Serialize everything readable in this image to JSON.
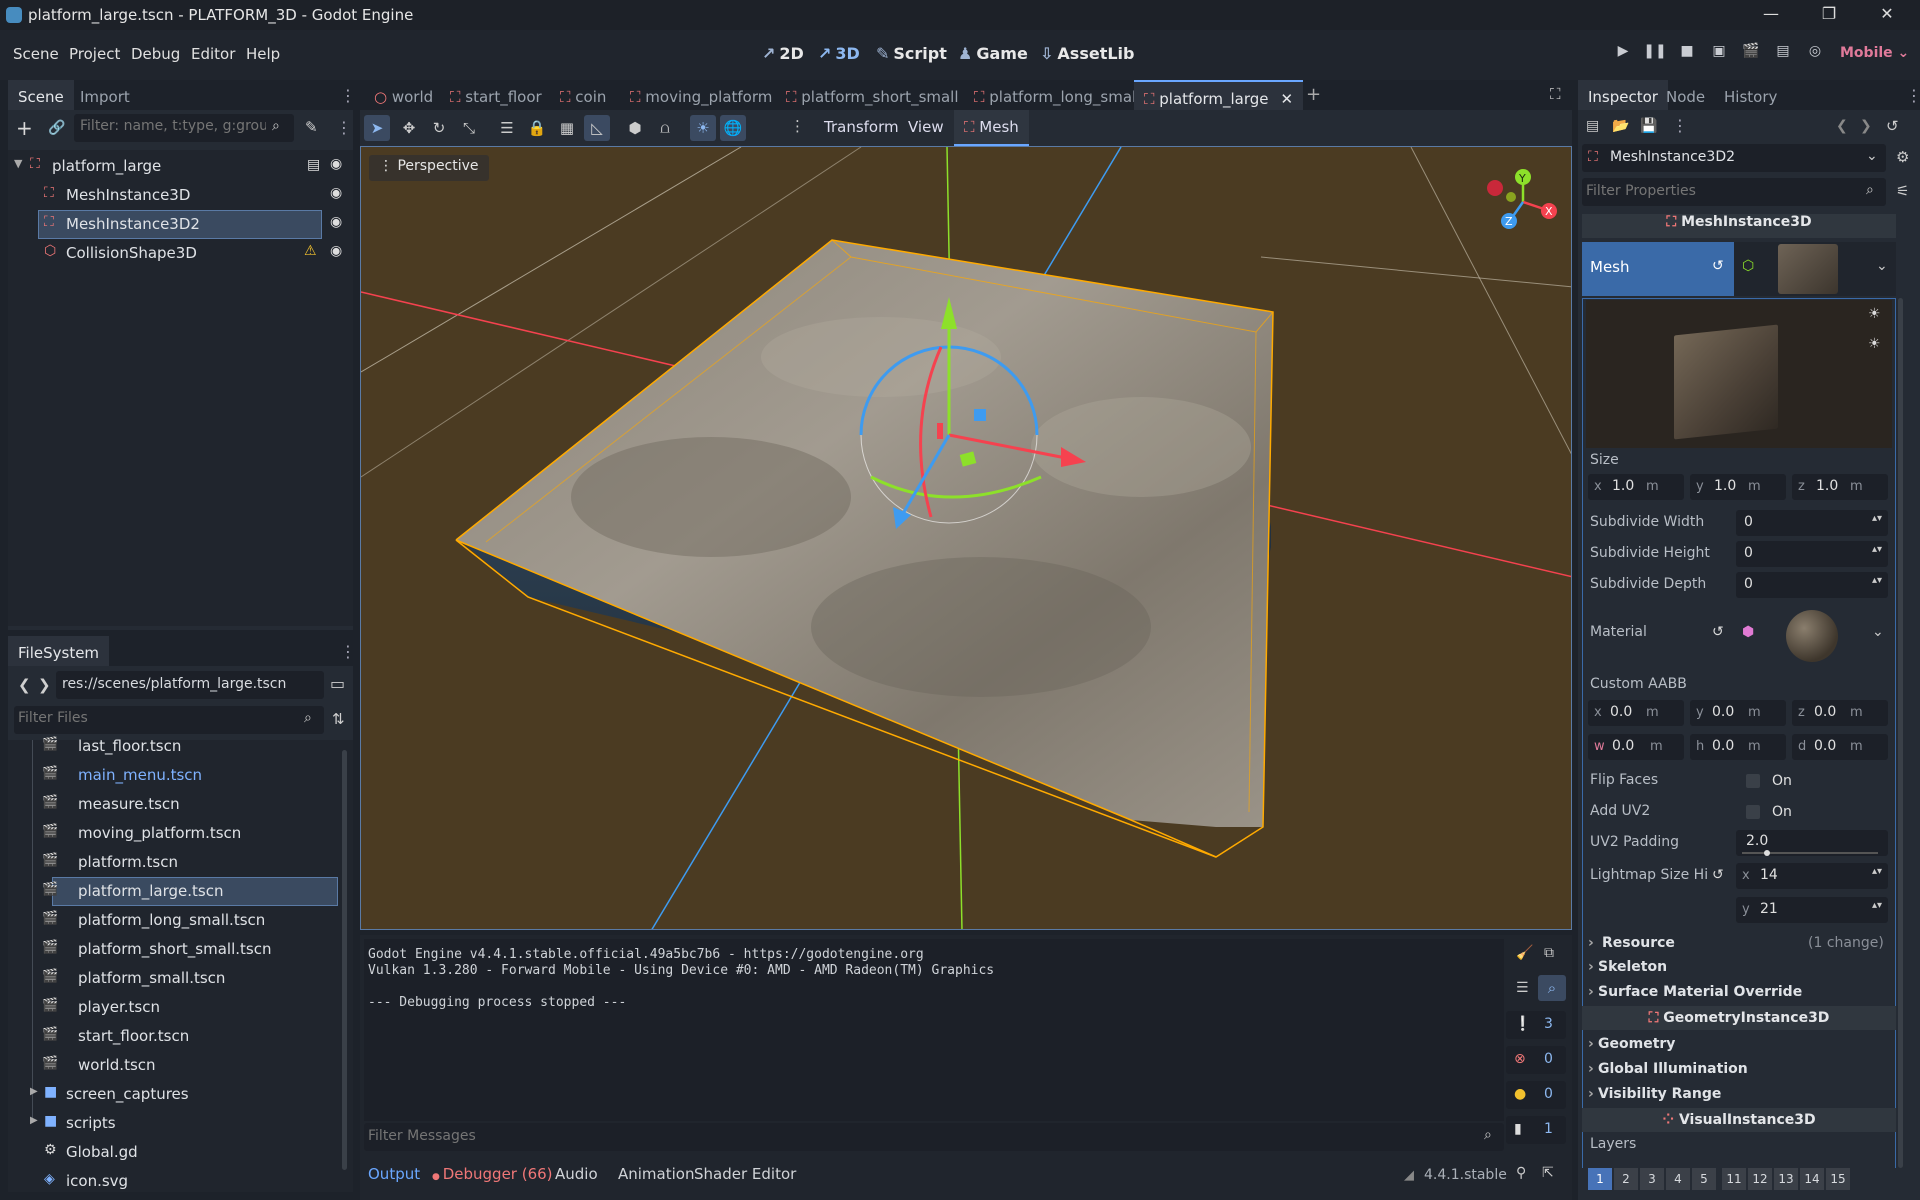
{
  "window": {
    "title": "platform_large.tscn - PLATFORM_3D - Godot Engine"
  },
  "menu": [
    "Scene",
    "Project",
    "Debug",
    "Editor",
    "Help"
  ],
  "workspaces": [
    {
      "label": "2D",
      "icon": "2d-icon"
    },
    {
      "label": "3D",
      "icon": "3d-icon"
    },
    {
      "label": "Script",
      "icon": "script-icon"
    },
    {
      "label": "Game",
      "icon": "game-icon"
    },
    {
      "label": "AssetLib",
      "icon": "assetlib-icon"
    }
  ],
  "renderer": "Mobile",
  "scene_panel": {
    "tabs": [
      "Scene",
      "Import"
    ],
    "filter_placeholder": "Filter: name, t:type, g:group",
    "nodes": [
      {
        "label": "platform_large",
        "level": 0
      },
      {
        "label": "MeshInstance3D",
        "level": 1
      },
      {
        "label": "MeshInstance3D2",
        "level": 1,
        "selected": true
      },
      {
        "label": "CollisionShape3D",
        "level": 1,
        "warning": true
      }
    ]
  },
  "filesystem": {
    "tab": "FileSystem",
    "path": "res://scenes/platform_large.tscn",
    "filter_placeholder": "Filter Files",
    "files": [
      {
        "label": "last_floor.tscn"
      },
      {
        "label": "main_menu.tscn",
        "highlight": true
      },
      {
        "label": "measure.tscn"
      },
      {
        "label": "moving_platform.tscn"
      },
      {
        "label": "platform.tscn"
      },
      {
        "label": "platform_large.tscn",
        "selected": true
      },
      {
        "label": "platform_long_small.tscn"
      },
      {
        "label": "platform_short_small.tscn"
      },
      {
        "label": "platform_small.tscn"
      },
      {
        "label": "player.tscn"
      },
      {
        "label": "start_floor.tscn"
      },
      {
        "label": "world.tscn"
      }
    ],
    "folders": [
      "screen_captures",
      "scripts"
    ],
    "root_files": [
      "Global.gd",
      "icon.svg"
    ]
  },
  "scene_tabs": [
    "world",
    "start_floor",
    "coin",
    "moving_platform",
    "platform_short_small",
    "platform_long_small",
    "platform_large"
  ],
  "active_scene_tab": "platform_large",
  "toolbar": {
    "transform": "Transform",
    "view": "View",
    "mesh": "Mesh"
  },
  "viewport": {
    "perspective": "Perspective"
  },
  "inspector": {
    "tabs": [
      "Inspector",
      "Node",
      "History"
    ],
    "node_name": "MeshInstance3D2",
    "filter_placeholder": "Filter Properties",
    "class_header": "MeshInstance3D",
    "mesh_label": "Mesh",
    "size_label": "Size",
    "size": {
      "x": "1.0",
      "y": "1.0",
      "z": "1.0",
      "unit": "m"
    },
    "subdivide": [
      {
        "label": "Subdivide Width",
        "value": "0"
      },
      {
        "label": "Subdivide Height",
        "value": "0"
      },
      {
        "label": "Subdivide Depth",
        "value": "0"
      }
    ],
    "material_label": "Material",
    "aabb_label": "Custom AABB",
    "aabb": {
      "x": "0.0",
      "y": "0.0",
      "z": "0.0",
      "w": "0.0",
      "h": "0.0",
      "d": "0.0"
    },
    "flip_faces": {
      "label": "Flip Faces",
      "value": "On"
    },
    "add_uv2": {
      "label": "Add UV2",
      "value": "On"
    },
    "uv2_padding": {
      "label": "UV2 Padding",
      "value": "2.0"
    },
    "lightmap": {
      "label": "Lightmap Size Hi",
      "x": "14",
      "y": "21"
    },
    "resource": {
      "label": "Resource",
      "changes": "(1 change)"
    },
    "sections": [
      "Skeleton",
      "Surface Material Override"
    ],
    "geometry_header": "GeometryInstance3D",
    "geometry_sections": [
      "Geometry",
      "Global Illumination",
      "Visibility Range"
    ],
    "visual_header": "VisualInstance3D",
    "layers_label": "Layers",
    "layers": [
      "1",
      "2",
      "3",
      "4",
      "5",
      "11",
      "12",
      "13",
      "14",
      "15"
    ]
  },
  "output": {
    "lines": [
      "Godot Engine v4.4.1.stable.official.49a5bc7b6 - https://godotengine.org",
      "Vulkan 1.3.280 - Forward Mobile - Using Device #0: AMD - AMD Radeon(TM) Graphics",
      "",
      "--- Debugging process stopped ---"
    ],
    "filter_placeholder": "Filter Messages",
    "counts": {
      "messages": "3",
      "errors": "0",
      "warnings": "0",
      "other": "1"
    }
  },
  "bottom_tabs": [
    "Output",
    "Debugger (66)",
    "Audio",
    "Animation",
    "Shader Editor"
  ],
  "version": "4.4.1.stable",
  "colors": {
    "accent": "#6aa7ff",
    "selection": "#3a4a60",
    "viewport_bg": "#4b3b22",
    "gizmo_x": "#f5424f",
    "gizmo_y": "#8de02a",
    "gizmo_z": "#3e9bf0",
    "aabb": "#ffaa00"
  }
}
